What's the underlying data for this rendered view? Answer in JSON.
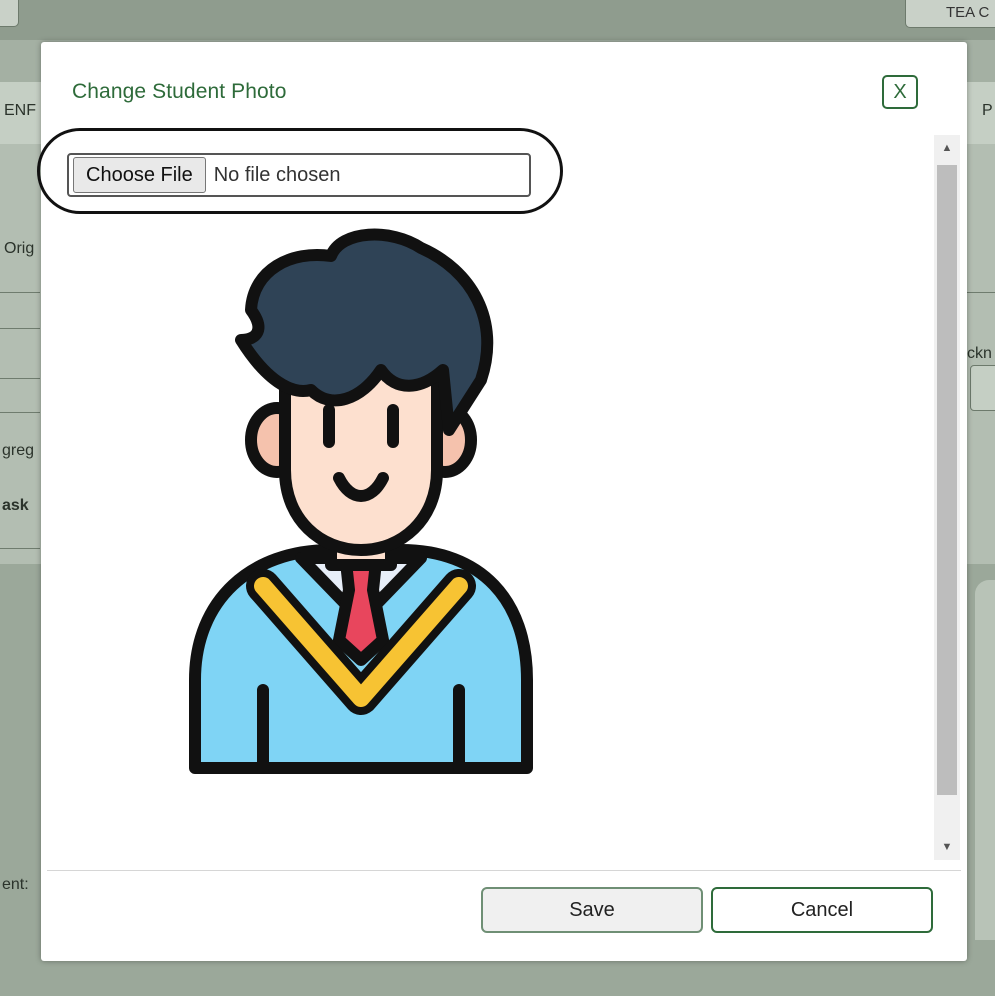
{
  "background": {
    "top_button_text": "TEA C",
    "fragments": [
      "ENF",
      "P",
      "Orig",
      "ckn",
      "greg",
      "ask",
      "ent:"
    ]
  },
  "modal": {
    "title": "Change Student Photo",
    "close_label": "X",
    "file_input": {
      "button_label": "Choose File",
      "status_text": "No file chosen"
    },
    "photo": {
      "icon": "student-avatar-icon"
    },
    "footer": {
      "save_label": "Save",
      "cancel_label": "Cancel"
    }
  },
  "colors": {
    "accent_green": "#2e6b3a",
    "hair": "#2f4356",
    "skin": "#fde0cf",
    "shirt": "#7fd4f5",
    "collar_stripe": "#f7c333",
    "tie": "#e8465d"
  }
}
